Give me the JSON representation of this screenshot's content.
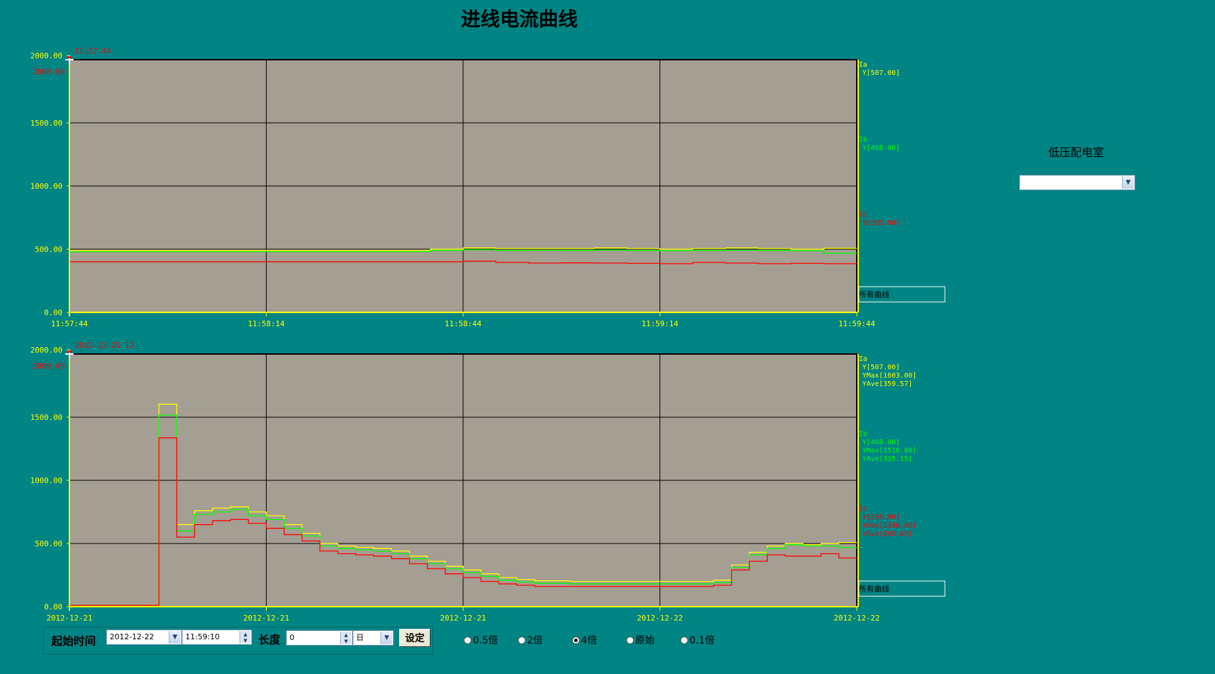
{
  "page": {
    "title": "进线电流曲线"
  },
  "room": {
    "label": "低压配电室",
    "selected": ""
  },
  "colors": {
    "background": "#008484",
    "plot_bg": "#A59E93",
    "ia": "#FFFF00",
    "ib": "#00FF00",
    "ic": "#FF0000",
    "axis": "#FFFF00"
  },
  "chart1": {
    "top_label": "11:57:44",
    "y_ticks_left": [
      "2000.00",
      "1500.00",
      "1000.00",
      "500.00",
      "0.00"
    ],
    "y_top_red": "2000.00",
    "x_ticks": [
      "11:57:44",
      "11:58:14",
      "11:58:44",
      "11:59:14",
      "11:59:44"
    ],
    "legend": {
      "ia": {
        "name": "Ia",
        "lines": [
          "Y[507.00]"
        ]
      },
      "ib": {
        "name": "Ib",
        "lines": [
          "Y[468.00]"
        ]
      },
      "ic": {
        "name": "Ic",
        "lines": [
          "Y[385.00]"
        ]
      }
    },
    "all_curves_label": "所有曲线"
  },
  "chart2": {
    "top_label": "2012-12-21 11",
    "y_ticks_left": [
      "2000.00",
      "1500.00",
      "1000.00",
      "500.00",
      "0.00"
    ],
    "y_top_red": "2000.00",
    "x_ticks": [
      "2012-12-21",
      "2012-12-21",
      "2012-12-21",
      "2012-12-22",
      "2012-12-22"
    ],
    "legend": {
      "ia": {
        "name": "Ia",
        "lines": [
          "Y[507.00]",
          "YMax[1603.00]",
          "YAve[359.57]"
        ]
      },
      "ib": {
        "name": "Ib",
        "lines": [
          "Y[468.00]",
          "YMax[1516.00]",
          "YAve[335.15]"
        ]
      },
      "ic": {
        "name": "Ic",
        "lines": [
          "Y[385.00]",
          "YMax[1336.00]",
          "YAve[293.65]"
        ]
      }
    },
    "all_curves_label": "所有曲线"
  },
  "chart_data": [
    {
      "type": "line",
      "title": "",
      "x": [
        "11:57:44",
        "11:58:14",
        "11:58:44",
        "11:59:14",
        "11:59:44"
      ],
      "ylim": [
        0,
        2000
      ],
      "grid": true,
      "legend": "right",
      "series": [
        {
          "name": "Ia",
          "color": "#FFFF00",
          "values": [
            490,
            490,
            490,
            490,
            490,
            490,
            490,
            490,
            490,
            490,
            490,
            500,
            510,
            505,
            505,
            505,
            510,
            505,
            500,
            505,
            510,
            505,
            500,
            507
          ]
        },
        {
          "name": "Ib",
          "color": "#00FF00",
          "values": [
            480,
            480,
            480,
            480,
            480,
            480,
            480,
            480,
            480,
            480,
            480,
            490,
            495,
            490,
            492,
            490,
            493,
            490,
            488,
            490,
            492,
            490,
            488,
            468
          ]
        },
        {
          "name": "Ic",
          "color": "#FF0000",
          "values": [
            400,
            400,
            400,
            400,
            400,
            400,
            400,
            400,
            400,
            400,
            400,
            400,
            405,
            395,
            390,
            392,
            390,
            388,
            385,
            395,
            390,
            385,
            388,
            385
          ]
        }
      ]
    },
    {
      "type": "line",
      "title": "",
      "x": [
        "2012-12-21",
        "2012-12-21",
        "2012-12-21",
        "2012-12-22",
        "2012-12-22"
      ],
      "ylim": [
        0,
        2000
      ],
      "grid": true,
      "legend": "right",
      "series": [
        {
          "name": "Ia",
          "color": "#FFFF00",
          "values": [
            10,
            10,
            10,
            10,
            10,
            1603,
            650,
            760,
            780,
            790,
            750,
            720,
            650,
            580,
            500,
            480,
            470,
            460,
            440,
            400,
            360,
            320,
            290,
            260,
            230,
            215,
            205,
            205,
            200,
            200,
            200,
            200,
            200,
            200,
            200,
            200,
            210,
            330,
            430,
            480,
            500,
            490,
            500,
            507
          ]
        },
        {
          "name": "Ib",
          "color": "#00FF00",
          "values": [
            10,
            10,
            10,
            10,
            10,
            1516,
            600,
            730,
            750,
            770,
            720,
            690,
            620,
            560,
            480,
            460,
            450,
            440,
            420,
            380,
            340,
            300,
            270,
            240,
            210,
            195,
            185,
            185,
            180,
            180,
            180,
            180,
            180,
            180,
            180,
            180,
            190,
            310,
            410,
            460,
            490,
            480,
            480,
            468
          ]
        },
        {
          "name": "Ic",
          "color": "#FF0000",
          "values": [
            10,
            10,
            10,
            10,
            10,
            1336,
            550,
            650,
            680,
            690,
            660,
            620,
            570,
            520,
            440,
            420,
            410,
            400,
            380,
            340,
            300,
            260,
            230,
            200,
            180,
            170,
            160,
            160,
            160,
            160,
            160,
            160,
            160,
            160,
            160,
            160,
            170,
            290,
            360,
            410,
            400,
            400,
            420,
            385
          ]
        }
      ]
    }
  ],
  "controls": {
    "start_label": "起始时间",
    "date_value": "2012-12-22",
    "time_value": "11:59:10",
    "length_label": "长度",
    "length_value": "0",
    "unit_value": "日",
    "set_label": "设定",
    "radios": [
      {
        "label": "0.5倍",
        "selected": false
      },
      {
        "label": "2倍",
        "selected": false
      },
      {
        "label": "4倍",
        "selected": true
      },
      {
        "label": "原始",
        "selected": false
      },
      {
        "label": "0.1倍",
        "selected": false
      }
    ]
  }
}
